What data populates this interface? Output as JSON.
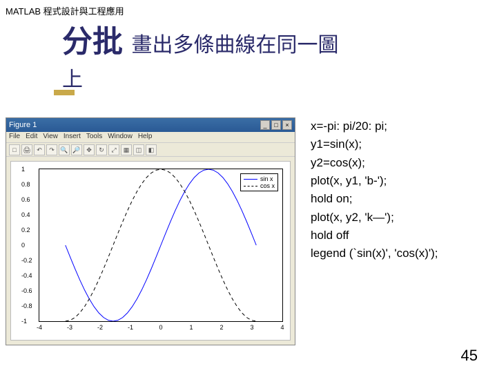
{
  "header": "MATLAB 程式設計與工程應用",
  "title": {
    "main": "分批",
    "sub": "畫出多條曲線在同一圖",
    "sub2": "上"
  },
  "figure_window": {
    "title": "Figure 1",
    "menus": [
      "File",
      "Edit",
      "View",
      "Insert",
      "Tools",
      "Window",
      "Help"
    ],
    "toolbar_icons": [
      "□",
      "🖨",
      "↶",
      "↷",
      "🔍",
      "🔎",
      "✥",
      "↻",
      "⤢",
      "▦",
      "◫",
      "◧"
    ]
  },
  "code": [
    "x=-pi: pi/20: pi;",
    "y1=sin(x);",
    "y2=cos(x);",
    "plot(x, y1, 'b-');",
    "hold on;",
    "plot(x, y2, 'k—');",
    "hold off",
    "legend (`sin(x)', 'cos(x)');"
  ],
  "page_number": "45",
  "chart_data": {
    "type": "line",
    "xlabel": "",
    "ylabel": "",
    "xlim": [
      -4,
      4
    ],
    "ylim": [
      -1,
      1
    ],
    "x_ticks": [
      -4,
      -3,
      -2,
      -1,
      0,
      1,
      2,
      3,
      4
    ],
    "y_ticks": [
      -1,
      -0.8,
      -0.6,
      -0.4,
      -0.2,
      0,
      0.2,
      0.4,
      0.6,
      0.8,
      1
    ],
    "legend": {
      "position": "upper-right",
      "entries": [
        "sin x",
        "cos x"
      ]
    },
    "x": [
      -3.1416,
      -2.9845,
      -2.8274,
      -2.6704,
      -2.5133,
      -2.3562,
      -2.1991,
      -2.042,
      -1.885,
      -1.7279,
      -1.5708,
      -1.4137,
      -1.2566,
      -1.0996,
      -0.9425,
      -0.7854,
      -0.6283,
      -0.4712,
      -0.3142,
      -0.1571,
      0,
      0.1571,
      0.3142,
      0.4712,
      0.6283,
      0.7854,
      0.9425,
      1.0996,
      1.2566,
      1.4137,
      1.5708,
      1.7279,
      1.885,
      2.042,
      2.1991,
      2.3562,
      2.5133,
      2.6704,
      2.8274,
      2.9845,
      3.1416
    ],
    "series": [
      {
        "name": "sin x",
        "style": "solid",
        "color": "#0000ff",
        "values": [
          0,
          -0.1564,
          -0.309,
          -0.454,
          -0.5878,
          -0.7071,
          -0.809,
          -0.891,
          -0.9511,
          -0.9877,
          -1,
          -0.9877,
          -0.9511,
          -0.891,
          -0.809,
          -0.7071,
          -0.5878,
          -0.454,
          -0.309,
          -0.1564,
          0,
          0.1564,
          0.309,
          0.454,
          0.5878,
          0.7071,
          0.809,
          0.891,
          0.9511,
          0.9877,
          1,
          0.9877,
          0.9511,
          0.891,
          0.809,
          0.7071,
          0.5878,
          0.454,
          0.309,
          0.1564,
          0
        ]
      },
      {
        "name": "cos x",
        "style": "dashed",
        "color": "#000000",
        "values": [
          -1,
          -0.9877,
          -0.9511,
          -0.891,
          -0.809,
          -0.7071,
          -0.5878,
          -0.454,
          -0.309,
          -0.1564,
          0,
          0.1564,
          0.309,
          0.454,
          0.5878,
          0.7071,
          0.809,
          0.891,
          0.9511,
          0.9877,
          1,
          0.9877,
          0.9511,
          0.891,
          0.809,
          0.7071,
          0.5878,
          0.454,
          0.309,
          0.1564,
          0,
          -0.1564,
          -0.309,
          -0.454,
          -0.5878,
          -0.7071,
          -0.809,
          -0.891,
          -0.9511,
          -0.9877,
          -1
        ]
      }
    ]
  }
}
